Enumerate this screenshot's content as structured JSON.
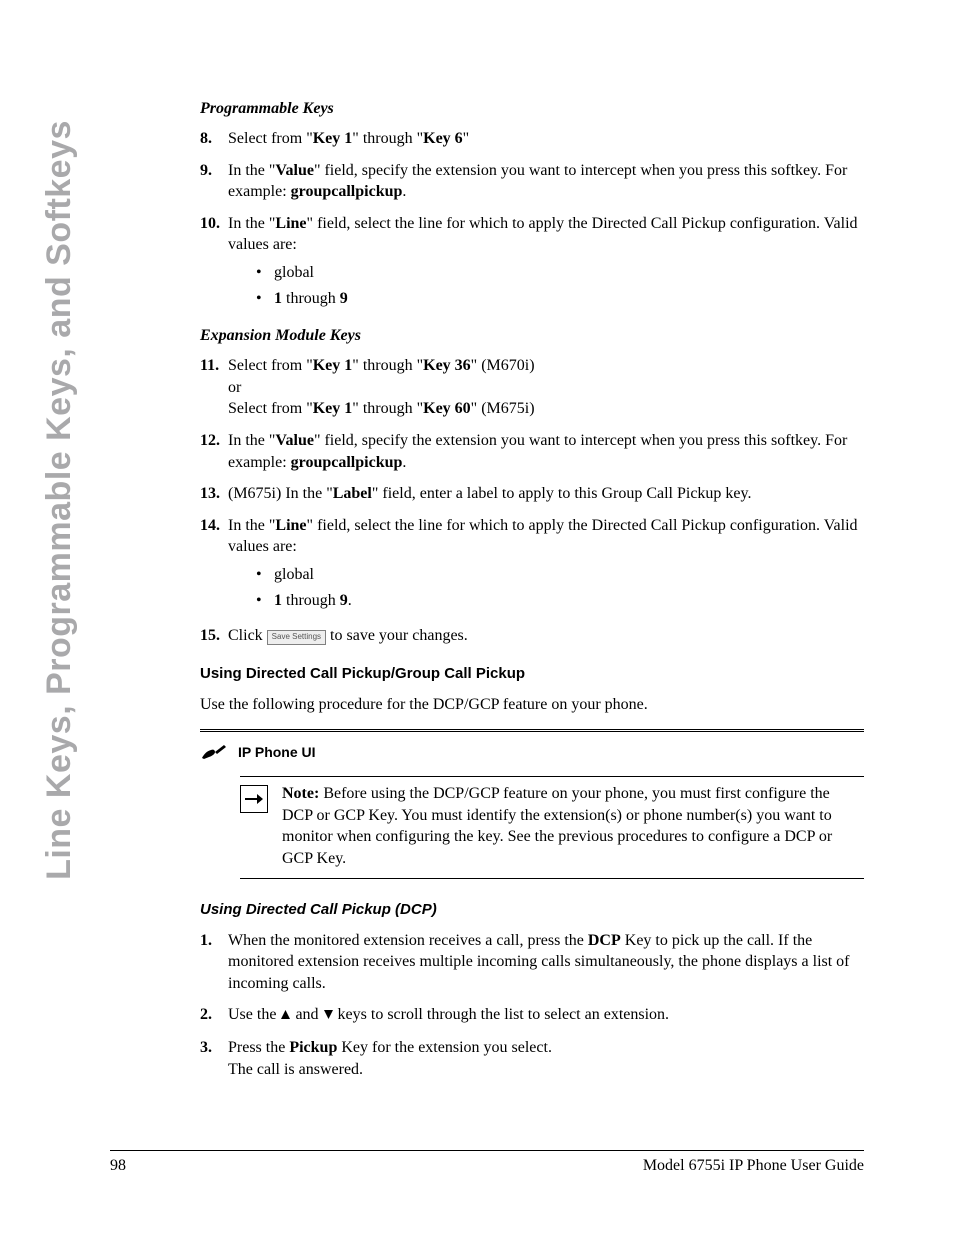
{
  "side_title": "Line Keys, Programmable Keys, and Softkeys",
  "sec_prog_keys": "Programmable Keys",
  "list_a": {
    "i8": {
      "num": "8.",
      "pre": "Select from \"",
      "k1": "Key 1",
      "mid": "\" through \"",
      "k6": "Key 6",
      "post": "\""
    },
    "i9": {
      "num": "9.",
      "t1": "In the \"",
      "val": "Value",
      "t2": "\" field, specify the extension you want to intercept when you press this softkey. For example: ",
      "ex": "groupcallpickup",
      "t3": "."
    },
    "i10": {
      "num": "10.",
      "t1": "In the \"",
      "line": "Line",
      "t2": "\" field, select the line for which to apply the Directed Call Pickup configuration. Valid values are:",
      "b1": "global",
      "b2a": "1",
      "b2m": " through ",
      "b2b": "9"
    }
  },
  "sec_exp_keys": "Expansion Module Keys",
  "list_b": {
    "i11": {
      "num": "11.",
      "t1": "Select from \"",
      "k1": "Key 1",
      "t2": "\" through \"",
      "k36": "Key 36",
      "t3": "\" (M670i)",
      "or": "or",
      "t4": "Select from \"",
      "k1b": "Key 1",
      "t5": "\" through \"",
      "k60": "Key 60",
      "t6": "\" (M675i)"
    },
    "i12": {
      "num": "12.",
      "t1": "In the \"",
      "val": "Value",
      "t2": "\" field, specify the extension you want to intercept when you press this softkey. For example: ",
      "ex": "groupcallpickup",
      "t3": "."
    },
    "i13": {
      "num": "13.",
      "t1": "(M675i) In the \"",
      "lab": "Label",
      "t2": "\" field, enter a label to apply to this Group Call Pickup key."
    },
    "i14": {
      "num": "14.",
      "t1": "In the \"",
      "line": "Line",
      "t2": "\" field, select the line for which to apply the Directed Call Pickup configuration. Valid values are:",
      "b1": "global",
      "b2a": "1",
      "b2m": " through ",
      "b2b": "9",
      "b2end": "."
    },
    "i15": {
      "num": "15.",
      "t1": "Click ",
      "btn": "Save Settings",
      "t2": " to save your changes."
    }
  },
  "h_using": "Using Directed Call Pickup/Group Call Pickup",
  "p_using": "Use the following procedure for the DCP/GCP feature on your phone.",
  "ui_label": "IP Phone UI",
  "note": {
    "lead": "Note:",
    "body": " Before using the DCP/GCP feature on your phone, you must first configure the DCP or GCP Key. You must identify the extension(s) or phone number(s) you want to monitor when configuring the key. See the previous procedures to configure a DCP or GCP Key."
  },
  "h_dcp": "Using Directed Call Pickup (DCP)",
  "list_c": {
    "i1": {
      "num": "1.",
      "t1": "When the monitored extension receives a call, press the ",
      "dcp": "DCP",
      "t2": " Key to pick up the call. If the monitored extension receives multiple incoming calls simultaneously, the phone displays a list of incoming calls."
    },
    "i2": {
      "num": "2.",
      "t1": "Use the ",
      "t2": " and ",
      "t3": " keys to scroll through the list to select an extension."
    },
    "i3": {
      "num": "3.",
      "t1": "Press the ",
      "pk": "Pickup",
      "t2": " Key for the extension you select.",
      "t3": "The call is answered."
    }
  },
  "footer": {
    "page": "98",
    "title": "Model 6755i IP Phone User Guide"
  }
}
